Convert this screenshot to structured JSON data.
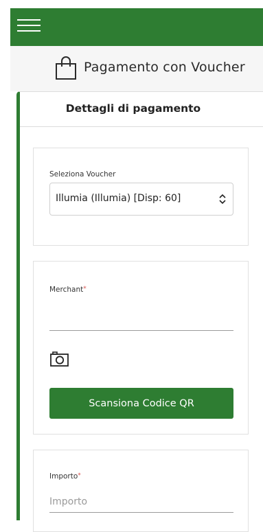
{
  "colors": {
    "brand_green": "#2e7d32",
    "required_marker": "#d9534f"
  },
  "topbar": {
    "menu_icon": "hamburger-menu-icon"
  },
  "header": {
    "icon": "shopping-bag-icon",
    "title": "Pagamento con Voucher"
  },
  "card": {
    "title": "Dettagli di pagamento"
  },
  "voucher": {
    "label": "Seleziona Voucher",
    "selected_value": "Illumia (Illumia) [Disp: 60]",
    "arrow_icon": "select-updown-icon"
  },
  "merchant": {
    "label": "Merchant",
    "required_marker": "*",
    "value": "",
    "camera_icon": "camera-icon",
    "scan_button_label": "Scansiona Codice QR"
  },
  "importo": {
    "label": "Importo",
    "required_marker": "*",
    "placeholder": "Importo",
    "value": ""
  }
}
